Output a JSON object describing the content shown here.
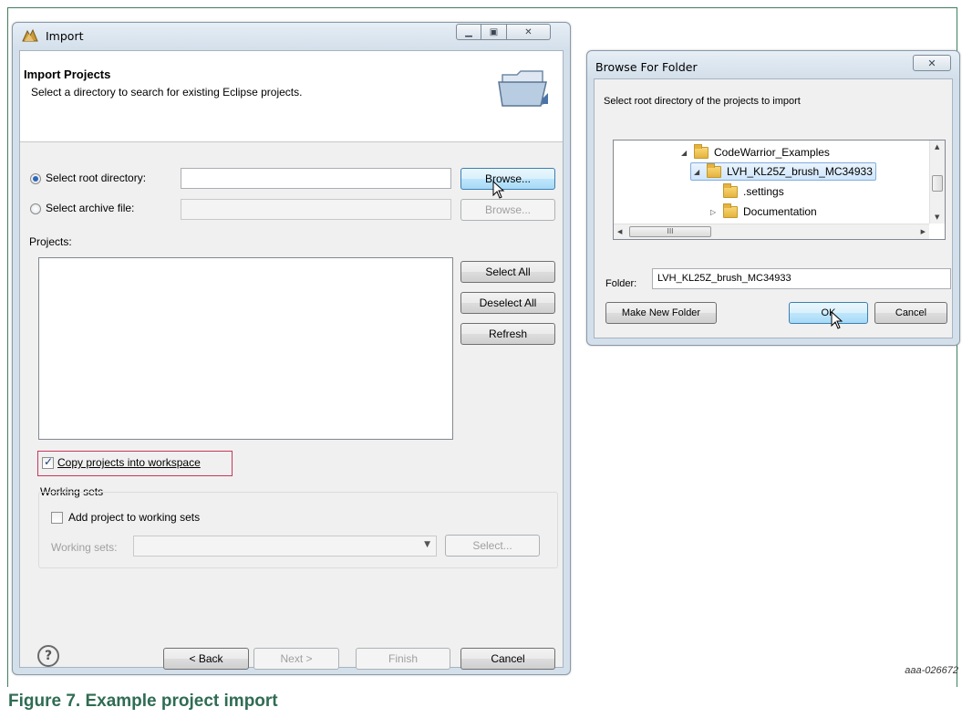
{
  "import_dialog": {
    "title": "Import",
    "controls": {
      "minimize": "minimize",
      "maximize": "maximize",
      "close": "close"
    },
    "banner_title": "Import Projects",
    "banner_description": "Select a directory to search for existing Eclipse projects.",
    "root_dir_label": "Select root directory:",
    "root_dir_value": "",
    "root_dir_selected": true,
    "archive_label": "Select archive file:",
    "archive_value": "",
    "browse_label": "Browse...",
    "projects_label": "Projects:",
    "select_all": "Select All",
    "deselect_all": "Deselect All",
    "refresh": "Refresh",
    "copy_projects_label": "Copy projects into workspace",
    "copy_projects_checked": true,
    "working_sets_group": "Working sets",
    "add_to_working_sets_label": "Add project to working sets",
    "add_to_working_sets_checked": false,
    "working_sets_label": "Working sets:",
    "working_sets_value": "",
    "select_button": "Select...",
    "help": "?",
    "back": "< Back",
    "next": "Next >",
    "finish": "Finish",
    "cancel": "Cancel"
  },
  "browse_dialog": {
    "title": "Browse For Folder",
    "close": "✕",
    "instruction": "Select root directory of the projects to import",
    "tree": [
      {
        "label": "CodeWarrior_Examples",
        "expanded": true,
        "selected": false
      },
      {
        "label": "LVH_KL25Z_brush_MC34933",
        "expanded": true,
        "selected": true
      },
      {
        "label": ".settings",
        "expanded": false,
        "selected": false
      },
      {
        "label": "Documentation",
        "expanded": false,
        "selected": false
      }
    ],
    "scroll_thumb": "III",
    "folder_label": "Folder:",
    "folder_value": "LVH_KL25Z_brush_MC34933",
    "make_new_folder": "Make New Folder",
    "ok": "OK",
    "cancel": "Cancel"
  },
  "figure_id": "aaa-026672",
  "caption": "Figure 7. Example project import",
  "colors": {
    "caption": "#2f6c53",
    "highlight_box": "#c8385a",
    "selection": "#cfe6fb"
  }
}
